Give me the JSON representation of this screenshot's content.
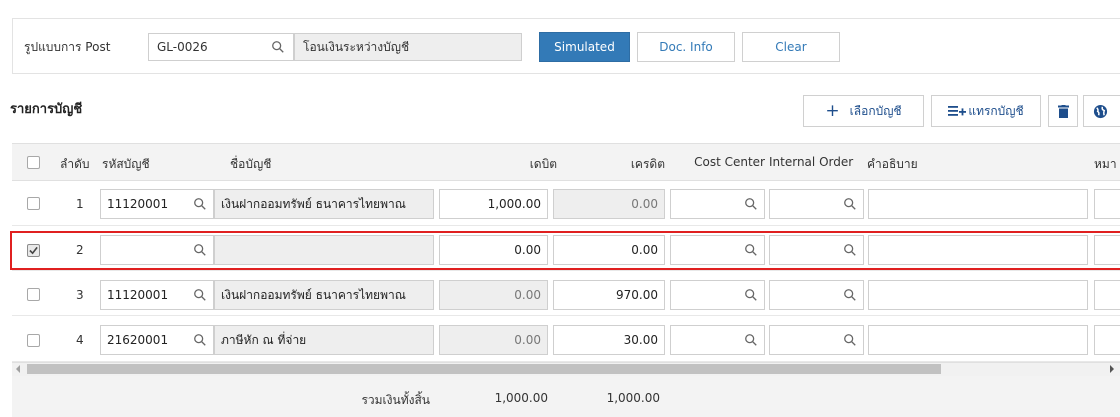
{
  "form": {
    "post_pattern_label": "รูปแบบการ Post",
    "post_code": "GL-0026",
    "post_desc": "โอนเงินระหว่างบัญชี",
    "simulated_label": "Simulated",
    "docinfo_label": "Doc. Info",
    "clear_label": "Clear"
  },
  "section": {
    "title": "รายการบัญชี",
    "select_account_label": "เลือกบัญชี",
    "insert_account_label": "แทรกบัญชี"
  },
  "table": {
    "headers": {
      "seq": "ลำดับ",
      "code": "รหัสบัญชี",
      "name": "ชื่อบัญชี",
      "debit": "เดบิต",
      "credit": "เครดิต",
      "cost_center": "Cost Center",
      "internal_order": "Internal Order",
      "description": "คำอธิบาย",
      "note": "หมา"
    },
    "rows": [
      {
        "seq": "1",
        "code": "11120001",
        "name": "เงินฝากออมทรัพย์ ธนาคารไทยพาณ",
        "debit": "1,000.00",
        "credit": "0.00"
      },
      {
        "seq": "2",
        "code": "",
        "name": "",
        "debit": "0.00",
        "credit": "0.00"
      },
      {
        "seq": "3",
        "code": "11120001",
        "name": "เงินฝากออมทรัพย์ ธนาคารไทยพาณ",
        "debit": "0.00",
        "credit": "970.00"
      },
      {
        "seq": "4",
        "code": "21620001",
        "name": "ภาษีหัก ณ ที่จ่าย",
        "debit": "0.00",
        "credit": "30.00"
      }
    ],
    "footer": {
      "total_label": "รวมเงินทั้งสิ้น",
      "total_debit": "1,000.00",
      "total_credit": "1,000.00"
    }
  },
  "colors": {
    "primary": "#337ab7",
    "highlight": "#e02020",
    "trash": "#1e4e8c"
  }
}
